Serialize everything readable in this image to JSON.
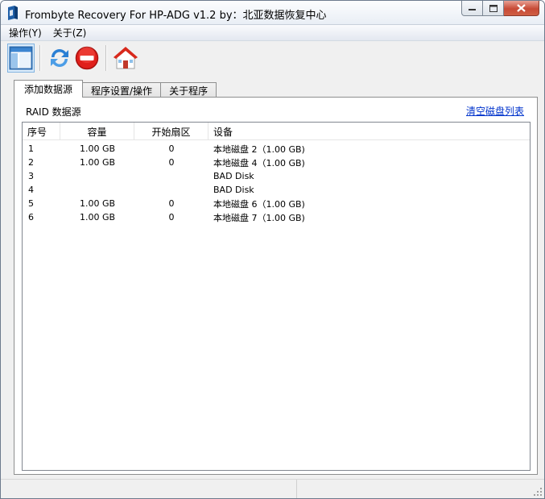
{
  "window": {
    "title": "Frombyte Recovery For HP-ADG v1.2 by：北亚数据恢复中心"
  },
  "menu": [
    {
      "label": "操作(Y)"
    },
    {
      "label": "关于(Z)"
    }
  ],
  "toolbar": {
    "buttons": [
      {
        "icon": "layout-panel-icon"
      },
      {
        "icon": "refresh-icon"
      },
      {
        "icon": "stop-icon"
      },
      {
        "icon": "home-icon"
      }
    ]
  },
  "tabs": [
    {
      "label": "添加数据源",
      "selected": true
    },
    {
      "label": "程序设置/操作",
      "selected": false
    },
    {
      "label": "关于程序",
      "selected": false
    }
  ],
  "panel": {
    "label": "RAID 数据源",
    "clear_link": "清空磁盘列表"
  },
  "table": {
    "columns": [
      "序号",
      "容量",
      "开始扇区",
      "设备"
    ],
    "rows": [
      {
        "index": "1",
        "capacity": "1.00 GB",
        "start_sector": "0",
        "device": "本地磁盘 2（1.00 GB)"
      },
      {
        "index": "2",
        "capacity": "1.00 GB",
        "start_sector": "0",
        "device": "本地磁盘 4（1.00 GB)"
      },
      {
        "index": "3",
        "capacity": "",
        "start_sector": "",
        "device": "BAD Disk"
      },
      {
        "index": "4",
        "capacity": "",
        "start_sector": "",
        "device": "BAD Disk"
      },
      {
        "index": "5",
        "capacity": "1.00 GB",
        "start_sector": "0",
        "device": "本地磁盘 6（1.00 GB)"
      },
      {
        "index": "6",
        "capacity": "1.00 GB",
        "start_sector": "0",
        "device": "本地磁盘 7（1.00 GB)"
      }
    ]
  },
  "colors": {
    "link": "#0033cc",
    "close_button": "#c74a36",
    "stop_icon": "#e0201b",
    "refresh_icon": "#2a7fd4"
  }
}
